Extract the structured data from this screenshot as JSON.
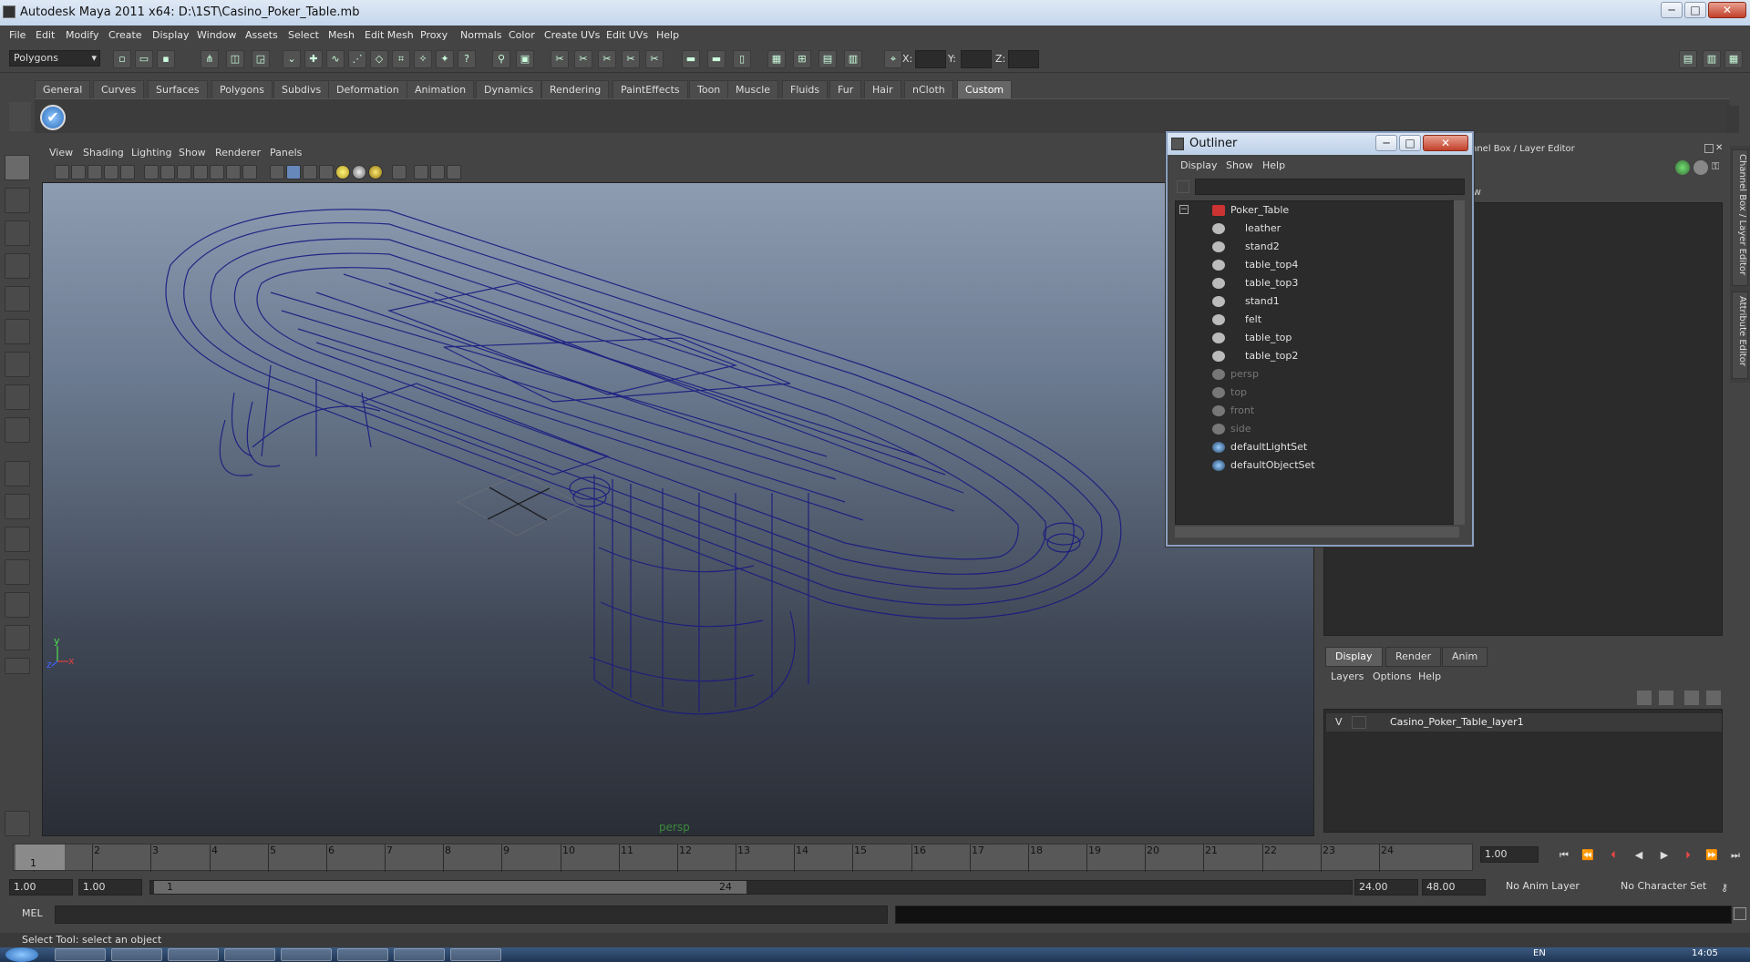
{
  "window": {
    "title": "Autodesk Maya 2011 x64: D:\\1ST\\Casino_Poker_Table.mb"
  },
  "menubar": [
    "File",
    "Edit",
    "Modify",
    "Create",
    "Display",
    "Window",
    "Assets",
    "Select",
    "Mesh",
    "Edit Mesh",
    "Proxy",
    "Normals",
    "Color",
    "Create UVs",
    "Edit UVs",
    "Help"
  ],
  "statusline": {
    "mode": "Polygons",
    "x_label": "X:",
    "y_label": "Y:",
    "z_label": "Z:"
  },
  "shelf_tabs": [
    "General",
    "Curves",
    "Surfaces",
    "Polygons",
    "Subdivs",
    "Deformation",
    "Animation",
    "Dynamics",
    "Rendering",
    "PaintEffects",
    "Toon",
    "Muscle",
    "Fluids",
    "Fur",
    "Hair",
    "nCloth",
    "Custom"
  ],
  "shelf_active_tab": "Custom",
  "viewport": {
    "menu": [
      "View",
      "Shading",
      "Lighting",
      "Show",
      "Renderer",
      "Panels"
    ],
    "camera_label": "persp",
    "axis_y": "y",
    "axis_x": "x",
    "axis_z": "z"
  },
  "outliner": {
    "title": "Outliner",
    "menu": [
      "Display",
      "Show",
      "Help"
    ],
    "items": [
      {
        "label": "Poker_Table",
        "depth": 0,
        "dim": false
      },
      {
        "label": "leather",
        "depth": 1,
        "dim": false
      },
      {
        "label": "stand2",
        "depth": 1,
        "dim": false
      },
      {
        "label": "table_top4",
        "depth": 1,
        "dim": false
      },
      {
        "label": "table_top3",
        "depth": 1,
        "dim": false
      },
      {
        "label": "stand1",
        "depth": 1,
        "dim": false
      },
      {
        "label": "felt",
        "depth": 1,
        "dim": false
      },
      {
        "label": "table_top",
        "depth": 1,
        "dim": false
      },
      {
        "label": "table_top2",
        "depth": 1,
        "dim": false
      },
      {
        "label": "persp",
        "depth": 0,
        "dim": true
      },
      {
        "label": "top",
        "depth": 0,
        "dim": true
      },
      {
        "label": "front",
        "depth": 0,
        "dim": true
      },
      {
        "label": "side",
        "depth": 0,
        "dim": true
      },
      {
        "label": "defaultLightSet",
        "depth": 0,
        "dim": false
      },
      {
        "label": "defaultObjectSet",
        "depth": 0,
        "dim": false
      }
    ]
  },
  "channel_box": {
    "header": "Channel Box / Layer Editor",
    "partial_header": "nnel Box / Layer Editor",
    "partial_w": "w"
  },
  "side_tabs": [
    "Channel Box / Layer Editor",
    "Attribute Editor"
  ],
  "layer_editor": {
    "tabs": [
      "Display",
      "Render",
      "Anim"
    ],
    "active_tab": "Display",
    "menu": [
      "Layers",
      "Options",
      "Help"
    ],
    "layers": [
      {
        "visible": "V",
        "name": "Casino_Poker_Table_layer1"
      }
    ]
  },
  "time_slider": {
    "ticks": [
      "1",
      "2",
      "3",
      "4",
      "5",
      "6",
      "7",
      "8",
      "9",
      "10",
      "11",
      "12",
      "13",
      "14",
      "15",
      "16",
      "17",
      "18",
      "19",
      "20",
      "21",
      "22",
      "23",
      "24"
    ],
    "current_frame": "1",
    "current_time_field": "1.00"
  },
  "range_slider": {
    "start_time": "1.00",
    "playback_start": "1.00",
    "range_start_label": "1",
    "range_end_label": "24",
    "playback_end": "24.00",
    "end_time": "48.00",
    "anim_layer": "No Anim Layer",
    "character_set": "No Character Set"
  },
  "command_line": {
    "label": "MEL"
  },
  "help_line": {
    "text": "Select Tool: select an object"
  },
  "taskbar": {
    "clock": "14:05",
    "lang": "EN"
  }
}
